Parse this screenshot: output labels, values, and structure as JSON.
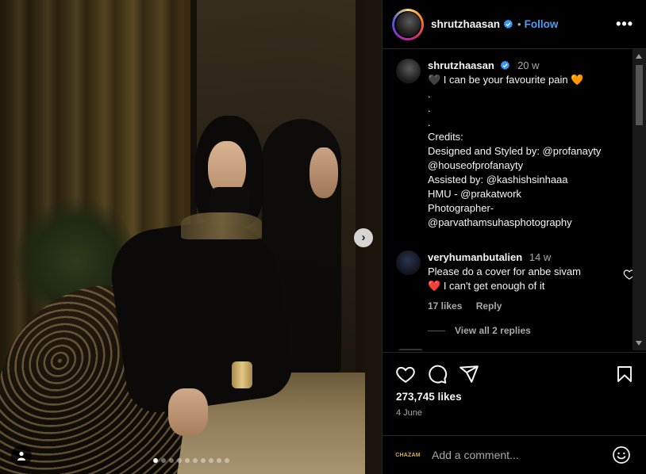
{
  "post": {
    "username": "shrutzhaasan",
    "follow_label": "Follow",
    "separator": "•",
    "more_label": "•••"
  },
  "caption": {
    "username": "shrutzhaasan",
    "time": "20 w",
    "lines": [
      "🖤 I can be your favourite pain 🧡",
      ".",
      ".",
      ".",
      "Credits:",
      "Designed and Styled by: @profanayty",
      "@houseofprofanayty",
      "Assisted by: @kashishsinhaaa",
      "HMU - @prakatwork",
      "Photographer-",
      "@parvathamsuhasphotography"
    ]
  },
  "comment": {
    "username": "veryhumanbutalien",
    "time": "14 w",
    "line1": "Please do a cover for anbe sivam",
    "heart": "❤️",
    "line2": "I can't get enough of it",
    "likes": "17 likes",
    "reply_label": "Reply",
    "view_replies": "View all 2 replies"
  },
  "actions": {
    "likes": "273,745 likes",
    "date": "4 June"
  },
  "add_comment": {
    "brand_text": "CHAZAM",
    "placeholder": "Add a comment..."
  },
  "carousel": {
    "next_label": "›",
    "count": 10,
    "active_index": 0
  },
  "icons": [
    "verified-icon",
    "more-icon",
    "heart-icon",
    "comment-icon",
    "share-icon",
    "bookmark-icon",
    "emoji-icon",
    "tag-icon",
    "next-icon"
  ],
  "colors": {
    "accent": "#4f9cf6",
    "background": "#000000",
    "muted": "#a8a8a8"
  }
}
